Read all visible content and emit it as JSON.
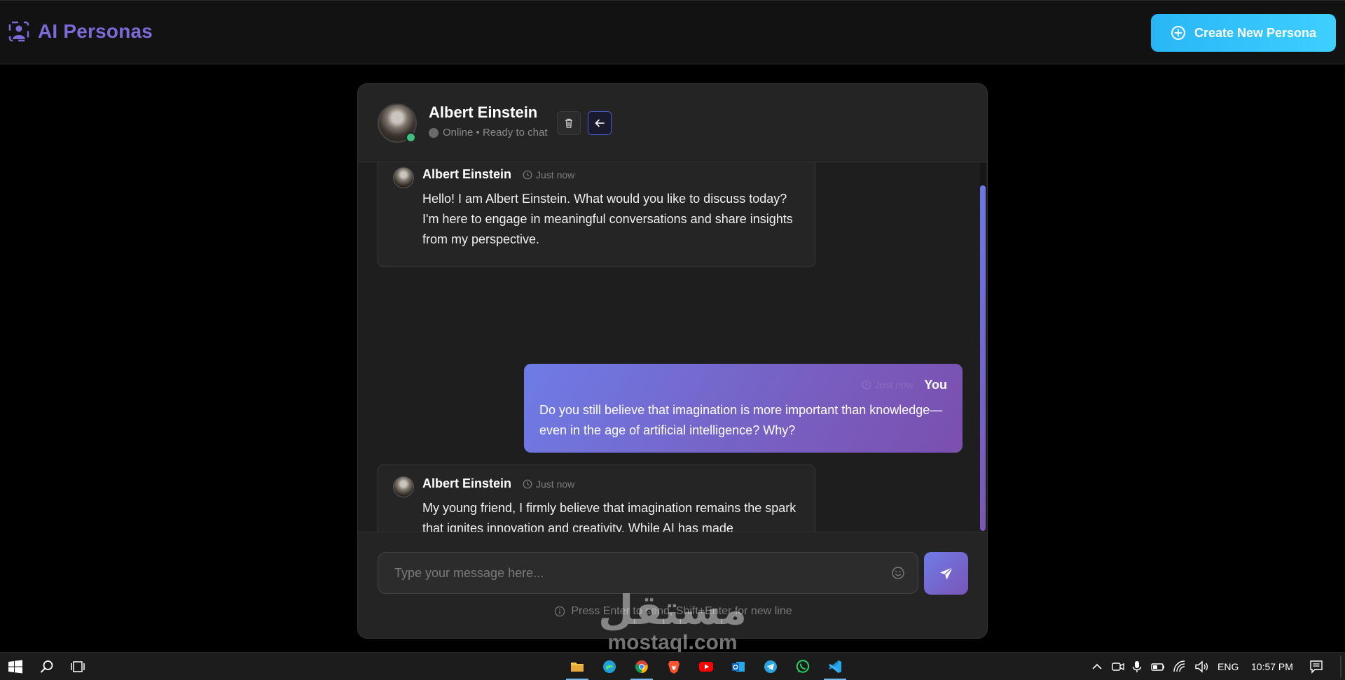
{
  "app": {
    "title": "AI Personas",
    "create_button_label": "Create New Persona"
  },
  "chat": {
    "persona_name": "Albert Einstein",
    "status_text": "Online • Ready to chat",
    "messages": [
      {
        "sender": "Albert Einstein",
        "time": "Just now",
        "text": "Hello! I am Albert Einstein. What would you like to discuss today? I'm here to engage in meaningful conversations and share insights from my perspective."
      },
      {
        "sender": "You",
        "time": "Just now",
        "text": "Do you still believe that imagination is more important than knowledge—even in the age of artificial intelligence? Why?"
      },
      {
        "sender": "Albert Einstein",
        "time": "Just now",
        "text": "My young friend, I firmly believe that imagination remains the spark that ignites innovation and creativity. While AI has made tremendous strides, it cannot replicate the boundless potential of human imagination."
      }
    ],
    "input": {
      "placeholder": "Type your message here...",
      "value": ""
    },
    "hint": "Press Enter to send, Shift+Enter for new line"
  },
  "watermark": {
    "arabic": "مستقل",
    "latin": "mostaql.com"
  },
  "taskbar": {
    "language": "ENG",
    "clock": "10:57 PM",
    "pinned_apps": [
      "file-explorer",
      "edge",
      "chrome",
      "brave",
      "youtube",
      "outlook",
      "telegram",
      "whatsapp",
      "vscode"
    ]
  },
  "colors": {
    "brand": "#7b6ad8",
    "create_button": "#29b6f6",
    "user_bubble_start": "#6e7ce6",
    "user_bubble_end": "#7b4fae",
    "online": "#3fbf7f"
  }
}
